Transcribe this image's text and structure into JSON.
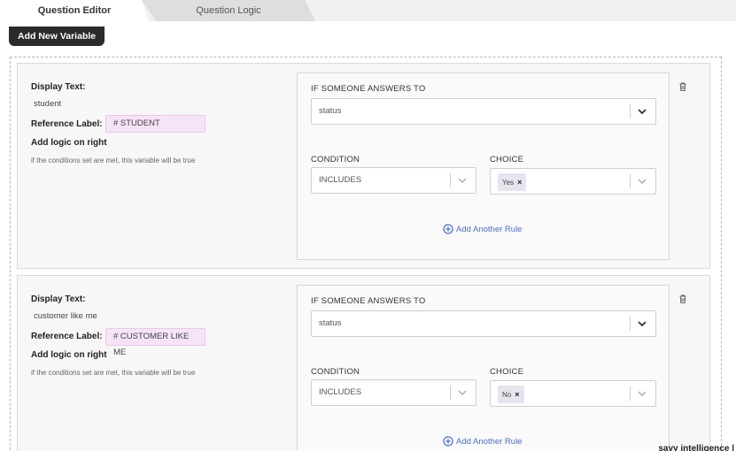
{
  "tabs": [
    {
      "label": "Question Editor",
      "active": true
    },
    {
      "label": "Question Logic",
      "active": false
    }
  ],
  "add_variable_label": "Add New Variable",
  "variables": [
    {
      "display_text_label": "Display Text:",
      "display_text": "student",
      "reference_label_label": "Reference Label:",
      "reference_label": "#  STUDENT",
      "add_logic_label": "Add logic on right",
      "hint": "if the conditions set are met, this variable will be true",
      "if_answers_label": "IF SOMEONE ANSWERS TO",
      "question_value": "status",
      "condition_label": "CONDITION",
      "condition_value": "INCLUDES",
      "choice_label": "CHOICE",
      "choice_chip": "Yes",
      "chip_remove": "×",
      "add_rule_label": "Add Another Rule"
    },
    {
      "display_text_label": "Display Text:",
      "display_text": "customer like me",
      "reference_label_label": "Reference Label:",
      "reference_label": "#  CUSTOMER LIKE ME",
      "add_logic_label": "Add logic on right",
      "hint": "if the conditions set are met, this variable will be true",
      "if_answers_label": "IF SOMEONE ANSWERS TO",
      "question_value": "status",
      "condition_label": "CONDITION",
      "condition_value": "INCLUDES",
      "choice_label": "CHOICE",
      "choice_chip": "No",
      "chip_remove": "×",
      "add_rule_label": "Add Another Rule"
    }
  ],
  "footer_brand": "sayy intelligence |",
  "icons": {
    "delete": "trash-icon",
    "dropdown": "chevron-down-icon",
    "add": "plus-circle-icon"
  },
  "colors": {
    "accent_link": "#4a6fc4",
    "reference_chip": "#f7e3f7",
    "button_dark": "#2b2b2b"
  }
}
